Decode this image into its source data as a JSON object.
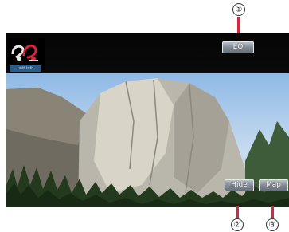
{
  "callouts": [
    "①",
    "②",
    "③"
  ],
  "top_bar": {
    "eq_label": "EQ",
    "logo_label": "SRS",
    "logo_band_text": "unit info"
  },
  "bottom_buttons": {
    "hide_label": "Hide",
    "map_label": "Map"
  }
}
